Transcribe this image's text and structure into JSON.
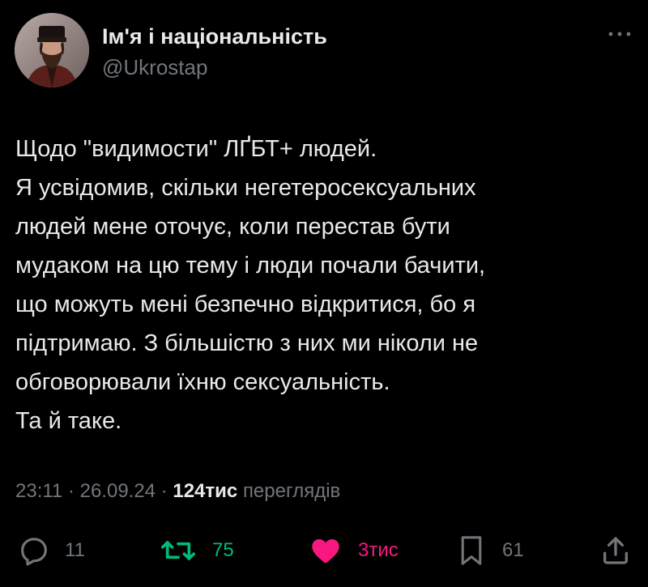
{
  "author": {
    "display_name": "Ім'я і національність",
    "handle": "@Ukrostap",
    "avatar": "avatar-photo"
  },
  "tweet": {
    "lines": [
      "Щодо \"видимости\" ЛҐБТ+ людей.",
      "Я усвідомив, скільки негетеросексуальних",
      "людей мене оточує, коли перестав бути",
      "мудаком на цю тему і люди почали бачити,",
      "що можуть мені безпечно відкритися, бо я",
      "підтримаю. З більшістю з них ми ніколи не",
      "обговорювали їхню сексуальність.",
      "Та й таке."
    ]
  },
  "meta": {
    "time": "23:11",
    "separator": " · ",
    "date": "26.09.24",
    "views_count": "124тис",
    "views_label": "переглядів"
  },
  "actions": {
    "replies": "11",
    "reposts": "75",
    "likes": "3тис",
    "bookmarks": "61"
  },
  "icons": {
    "more": "more-horizontal-icon",
    "reply": "reply-icon",
    "repost": "repost-icon",
    "like": "heart-icon",
    "bookmark": "bookmark-icon",
    "share": "share-icon"
  },
  "colors": {
    "background": "#000000",
    "text": "#e7e9ea",
    "secondary": "#71767b",
    "repost_active": "#00ba7c",
    "like_active": "#f91880"
  }
}
